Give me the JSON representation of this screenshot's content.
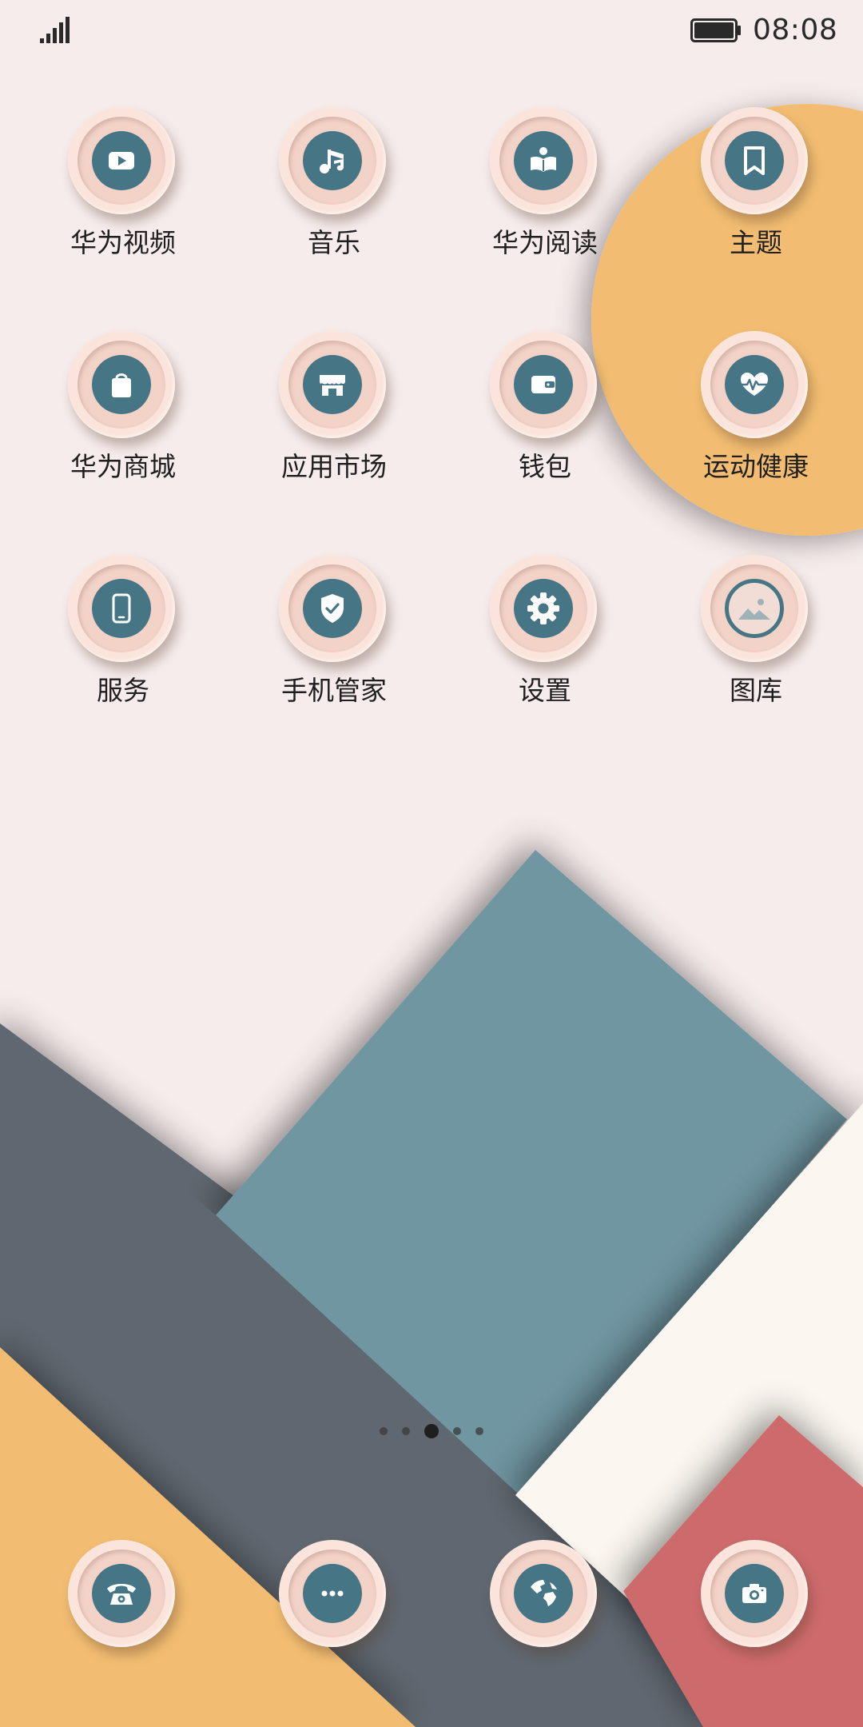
{
  "status_bar": {
    "time": "08:08",
    "signal_icon": "signal-icon",
    "battery_icon": "battery-icon"
  },
  "home": {
    "apps": [
      {
        "label": "华为视频",
        "icon": "video-icon"
      },
      {
        "label": "音乐",
        "icon": "music-icon"
      },
      {
        "label": "华为阅读",
        "icon": "reader-icon"
      },
      {
        "label": "主题",
        "icon": "bookmark-icon"
      },
      {
        "label": "华为商城",
        "icon": "shopping-bag-icon"
      },
      {
        "label": "应用市场",
        "icon": "store-icon"
      },
      {
        "label": "钱包",
        "icon": "wallet-icon"
      },
      {
        "label": "运动健康",
        "icon": "heart-pulse-icon"
      },
      {
        "label": "服务",
        "icon": "phone-card-icon"
      },
      {
        "label": "手机管家",
        "icon": "shield-check-icon"
      },
      {
        "label": "设置",
        "icon": "gear-icon"
      },
      {
        "label": "图库",
        "icon": "gallery-icon"
      }
    ],
    "page_indicator": {
      "count": 5,
      "active_index": 2
    }
  },
  "dock": {
    "apps": [
      {
        "icon": "phone-icon"
      },
      {
        "icon": "messages-icon"
      },
      {
        "icon": "browser-globe-icon"
      },
      {
        "icon": "camera-icon"
      }
    ]
  },
  "colors": {
    "background": "#f6ecec",
    "icon_disc": "#467685",
    "icon_ring": "#fbe4db",
    "wallpaper_orange": "#f2bd72",
    "wallpaper_teal": "#6f96a2",
    "wallpaper_slate": "#5f6770",
    "wallpaper_cream": "#fbf6f0",
    "wallpaper_red": "#cd6a6c"
  }
}
